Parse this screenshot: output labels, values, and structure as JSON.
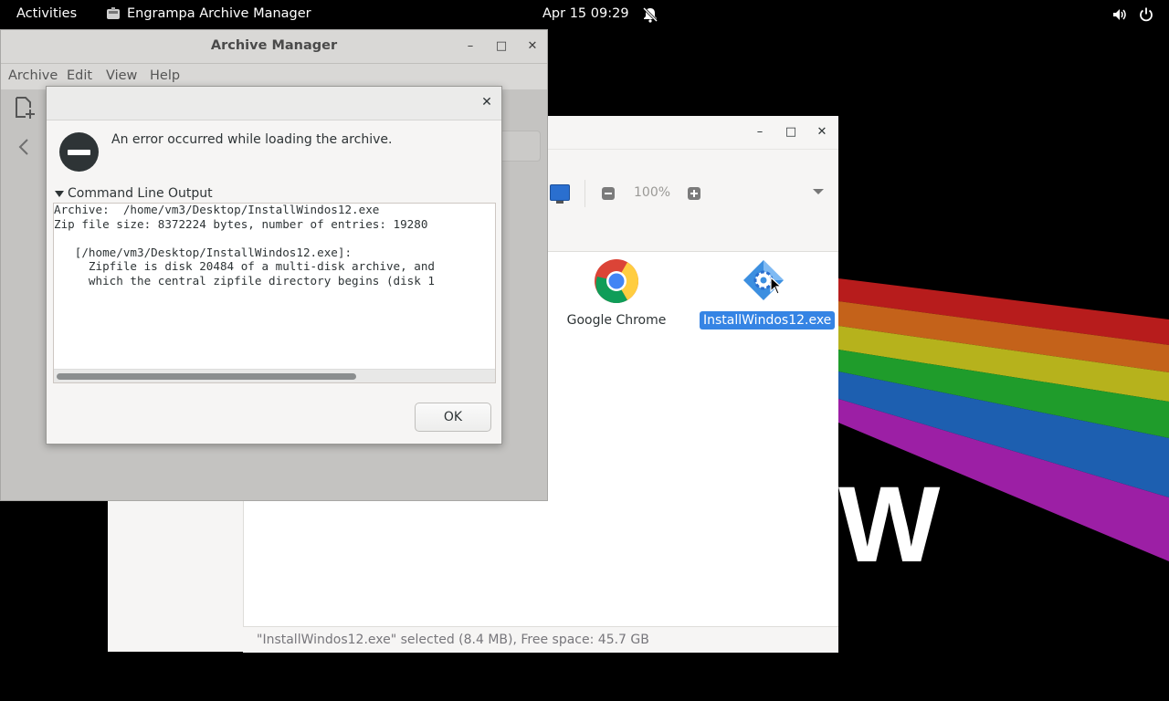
{
  "topbar": {
    "activities": "Activities",
    "app_name": "Engrampa Archive Manager",
    "clock": "Apr 15  09:29",
    "icons": [
      "notifications-off-icon",
      "volume-icon",
      "power-icon"
    ]
  },
  "file_manager": {
    "zoom_level": "100%",
    "items": [
      {
        "label": "Google Chrome",
        "icon": "chrome-icon",
        "selected": false
      },
      {
        "label": "InstallWindos12.exe",
        "icon": "exe-gear-icon",
        "selected": true
      }
    ],
    "status": "\"InstallWindos12.exe\" selected (8.4 MB), Free space: 45.7 GB"
  },
  "archive_manager": {
    "title": "Archive Manager",
    "menu": [
      "Archive",
      "Edit",
      "View",
      "Help"
    ]
  },
  "dialog": {
    "message": "An error occurred while loading the archive.",
    "expander_label": "Command Line Output",
    "output": "Archive:  /home/vm3/Desktop/InstallWindos12.exe\nZip file size: 8372224 bytes, number of entries: 19280\n\n   [/home/vm3/Desktop/InstallWindos12.exe]:\n     Zipfile is disk 20484 of a multi-disk archive, and\n     which the central zipfile directory begins (disk 1",
    "ok_label": "OK"
  },
  "colors": {
    "selection": "#3584e4",
    "topbar": "#000000",
    "dialog_bg": "#f6f5f4"
  }
}
